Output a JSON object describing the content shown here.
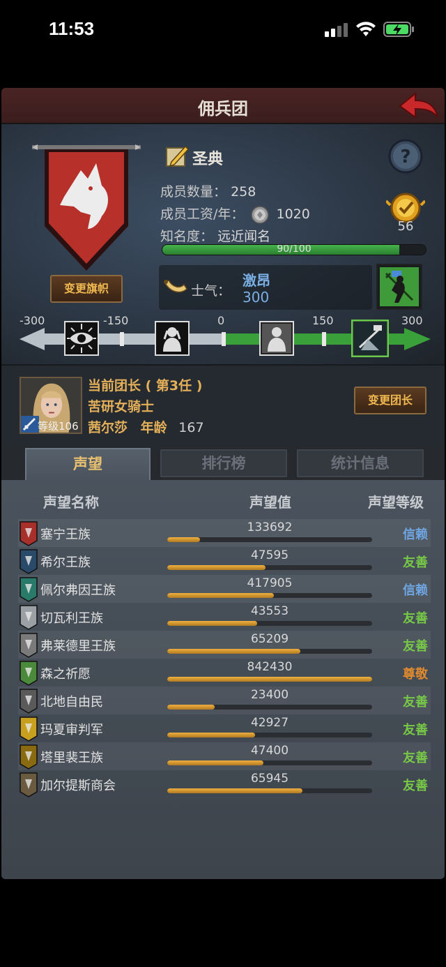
{
  "status_bar": {
    "time": "11:53"
  },
  "window": {
    "title": "佣兵团"
  },
  "company": {
    "name": "圣典",
    "members_label": "成员数量：",
    "members_value": "258",
    "wage_label": "成员工资/年：",
    "wage_value": "1020",
    "fame_label": "知名度：",
    "fame_value": "远近闻名",
    "fame_progress_text": "90/100",
    "fame_progress": 0.9,
    "medal_count": "56",
    "change_banner_label": "变更旗帜"
  },
  "morale": {
    "label": "士气：",
    "state": "激昂",
    "value": "300",
    "scale_labels": [
      "-300",
      "-150",
      "0",
      "150",
      "300"
    ]
  },
  "leader": {
    "title": "当前团长 ( 第3任 )",
    "class": "苦研女骑士",
    "name": "茜尔莎",
    "age_label": "年龄",
    "age_value": "167",
    "level_label": "等级106",
    "change_leader_label": "变更团长"
  },
  "tabs": [
    {
      "label": "声望",
      "active": true
    },
    {
      "label": "排行榜",
      "active": false
    },
    {
      "label": "统计信息",
      "active": false
    }
  ],
  "reputation": {
    "headers": {
      "name": "声望名称",
      "value": "声望值",
      "level": "声望等级"
    },
    "rows": [
      {
        "name": "塞宁王族",
        "value": "133692",
        "progress": 0.16,
        "level": "信赖",
        "level_type": "trust"
      },
      {
        "name": "希尔王族",
        "value": "47595",
        "progress": 0.48,
        "level": "友善",
        "level_type": "friendly"
      },
      {
        "name": "佩尔弗因王族",
        "value": "417905",
        "progress": 0.52,
        "level": "信赖",
        "level_type": "trust"
      },
      {
        "name": "切瓦利王族",
        "value": "43553",
        "progress": 0.44,
        "level": "友善",
        "level_type": "friendly"
      },
      {
        "name": "弗莱德里王族",
        "value": "65209",
        "progress": 0.65,
        "level": "友善",
        "level_type": "friendly"
      },
      {
        "name": "森之祈愿",
        "value": "842430",
        "progress": 1.0,
        "level": "尊敬",
        "level_type": "respect"
      },
      {
        "name": "北地自由民",
        "value": "23400",
        "progress": 0.23,
        "level": "友善",
        "level_type": "friendly"
      },
      {
        "name": "玛夏审判军",
        "value": "42927",
        "progress": 0.43,
        "level": "友善",
        "level_type": "friendly"
      },
      {
        "name": "塔里裴王族",
        "value": "47400",
        "progress": 0.47,
        "level": "友善",
        "level_type": "friendly"
      },
      {
        "name": "加尔提斯商会",
        "value": "65945",
        "progress": 0.66,
        "level": "友善",
        "level_type": "friendly"
      }
    ]
  }
}
